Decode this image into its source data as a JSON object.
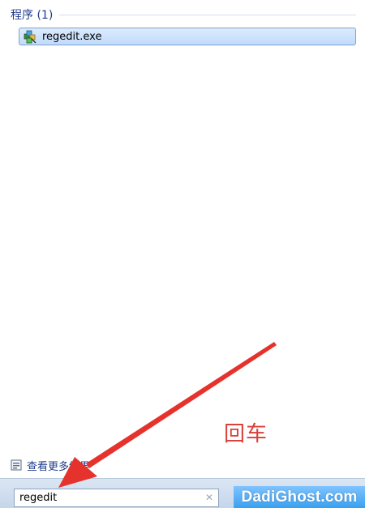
{
  "section": {
    "title": "程序 (1)"
  },
  "results": [
    {
      "label": "regedit.exe",
      "icon": "registry-editor-icon"
    }
  ],
  "see_more": {
    "label": "查看更多结果",
    "icon": "search-results-icon"
  },
  "search": {
    "value": "regedit",
    "clear_icon": "clear-icon"
  },
  "annotation": {
    "text": "回车",
    "color": "#d9403a"
  },
  "watermark": {
    "text": "DadiGhost.com"
  },
  "colors": {
    "section_title": "#1e3c8c",
    "selection_border": "#7da2ce",
    "arrow": "#e5322d"
  }
}
